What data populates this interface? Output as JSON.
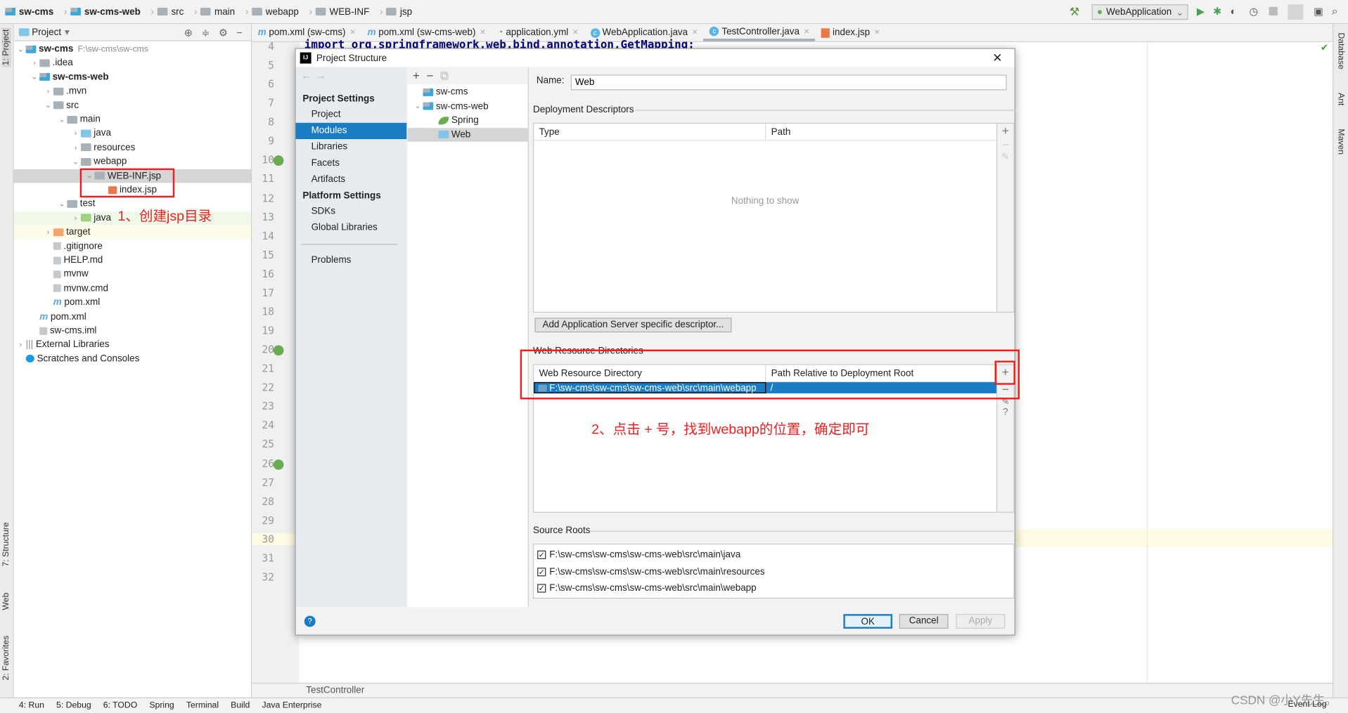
{
  "breadcrumb": [
    "sw-cms",
    "sw-cms-web",
    "src",
    "main",
    "webapp",
    "WEB-INF",
    "jsp"
  ],
  "run_config": "WebApplication",
  "project_panel": {
    "title": "Project",
    "tree": [
      {
        "label": "sw-cms",
        "hint": "F:\\sw-cms\\sw-cms",
        "depth": 0,
        "arrow": "v",
        "bold": true,
        "icon": "module"
      },
      {
        "label": ".idea",
        "depth": 1,
        "arrow": ">",
        "icon": "folder"
      },
      {
        "label": "sw-cms-web",
        "depth": 1,
        "arrow": "v",
        "bold": true,
        "icon": "module"
      },
      {
        "label": ".mvn",
        "depth": 2,
        "arrow": ">",
        "icon": "folder"
      },
      {
        "label": "src",
        "depth": 2,
        "arrow": "v",
        "icon": "folder"
      },
      {
        "label": "main",
        "depth": 3,
        "arrow": "v",
        "icon": "folder"
      },
      {
        "label": "java",
        "depth": 4,
        "arrow": ">",
        "icon": "blue"
      },
      {
        "label": "resources",
        "depth": 4,
        "arrow": ">",
        "icon": "folder"
      },
      {
        "label": "webapp",
        "depth": 4,
        "arrow": "v",
        "icon": "folder"
      },
      {
        "label": "WEB-INF.jsp",
        "depth": 5,
        "arrow": "v",
        "icon": "folder",
        "selected": true
      },
      {
        "label": "index.jsp",
        "depth": 6,
        "arrow": "",
        "icon": "jsp"
      },
      {
        "label": "test",
        "depth": 3,
        "arrow": "v",
        "icon": "folder"
      },
      {
        "label": "java",
        "depth": 4,
        "arrow": ">",
        "icon": "green",
        "bg": "#f0f8ea"
      },
      {
        "label": "target",
        "depth": 2,
        "arrow": ">",
        "icon": "orange",
        "bg": "#fcfce8"
      },
      {
        "label": ".gitignore",
        "depth": 2,
        "arrow": "",
        "icon": "file"
      },
      {
        "label": "HELP.md",
        "depth": 2,
        "arrow": "",
        "icon": "file"
      },
      {
        "label": "mvnw",
        "depth": 2,
        "arrow": "",
        "icon": "file"
      },
      {
        "label": "mvnw.cmd",
        "depth": 2,
        "arrow": "",
        "icon": "file"
      },
      {
        "label": "pom.xml",
        "depth": 2,
        "arrow": "",
        "icon": "maven"
      },
      {
        "label": "pom.xml",
        "depth": 1,
        "arrow": "",
        "icon": "maven"
      },
      {
        "label": "sw-cms.iml",
        "depth": 1,
        "arrow": "",
        "icon": "file"
      },
      {
        "label": "External Libraries",
        "depth": 0,
        "arrow": ">",
        "icon": "lib"
      },
      {
        "label": "Scratches and Consoles",
        "depth": 0,
        "arrow": "",
        "icon": "scratch"
      }
    ]
  },
  "tabs": [
    {
      "label": "pom.xml (sw-cms)",
      "icon": "m"
    },
    {
      "label": "pom.xml (sw-cms-web)",
      "icon": "m"
    },
    {
      "label": "application.yml",
      "icon": "yml"
    },
    {
      "label": "WebApplication.java",
      "icon": "c"
    },
    {
      "label": "TestController.java",
      "icon": "c",
      "active": true
    },
    {
      "label": "index.jsp",
      "icon": "jsp"
    }
  ],
  "editor": {
    "first_line": 4,
    "last_line": 32,
    "current_line": 30,
    "code_line": "import org.springframework.web.bind.annotation.GetMapping;",
    "nav_crumb": "TestController"
  },
  "left_stripe": [
    "1: Project",
    "7: Structure",
    "Web",
    "2: Favorites"
  ],
  "right_stripe": [
    "Database",
    "Ant",
    "Maven"
  ],
  "tool_windows": [
    "4: Run",
    "5: Debug",
    "6: TODO",
    "Spring",
    "Terminal",
    "Build",
    "Java Enterprise"
  ],
  "event_log": "Event Log",
  "watermark": "CSDN @小Y先生。",
  "dialog": {
    "title": "Project Structure",
    "nav": {
      "h1": "Project Settings",
      "items1": [
        "Project",
        "Modules",
        "Libraries",
        "Facets",
        "Artifacts"
      ],
      "h2": "Platform Settings",
      "items2": [
        "SDKs",
        "Global Libraries"
      ],
      "problems": "Problems",
      "selected": "Modules"
    },
    "modules": [
      {
        "label": "sw-cms"
      },
      {
        "label": "sw-cms-web"
      },
      {
        "label": "Spring"
      },
      {
        "label": "Web",
        "selected": true
      }
    ],
    "name_label": "Name:",
    "name_value": "Web",
    "dd": {
      "label": "Deployment Descriptors",
      "cols": [
        "Type",
        "Path"
      ],
      "empty": "Nothing to show",
      "add_button": "Add Application Server specific descriptor..."
    },
    "wrd": {
      "label": "Web Resource Directories",
      "cols": [
        "Web Resource Directory",
        "Path Relative to Deployment Root"
      ],
      "rows": [
        [
          "F:\\sw-cms\\sw-cms\\sw-cms-web\\src\\main\\webapp",
          "/"
        ]
      ]
    },
    "src": {
      "label": "Source Roots",
      "rows": [
        "F:\\sw-cms\\sw-cms\\sw-cms-web\\src\\main\\java",
        "F:\\sw-cms\\sw-cms\\sw-cms-web\\src\\main\\resources",
        "F:\\sw-cms\\sw-cms\\sw-cms-web\\src\\main\\webapp"
      ]
    },
    "ok": "OK",
    "cancel": "Cancel",
    "apply": "Apply"
  },
  "annotations": {
    "a1": "1、创建jsp目录",
    "a2": "2、点击 + 号，找到webapp的位置，确定即可",
    "color": "#f21d1d"
  }
}
